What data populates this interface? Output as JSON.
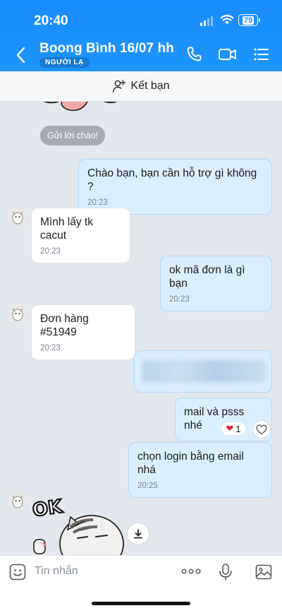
{
  "status_bar": {
    "time": "20:40",
    "battery": "79"
  },
  "header": {
    "title": "Boong Bình 16/07 hh",
    "badge": "NGƯỜI LẠ",
    "icons": [
      "back-icon",
      "phone-icon",
      "video-icon",
      "menu-icon"
    ]
  },
  "add_friend": {
    "label": "Kết bạn",
    "icon": "add-user-icon"
  },
  "greeting_chip": "Gửi lời chào!",
  "messages": [
    {
      "side": "out",
      "text": "Chào bạn, bạn cần hỗ trợ gì không ?",
      "time": "20:23"
    },
    {
      "side": "in",
      "text": "Mình lấy tk cacut",
      "time": "20:23"
    },
    {
      "side": "out",
      "text": "ok mã đơn là gì bạn",
      "time": "20:23"
    },
    {
      "side": "in",
      "text": "Đơn hàng #51949",
      "time": "20:23"
    },
    {
      "side": "out",
      "text": "mail và psss nhé",
      "time": ""
    },
    {
      "side": "out",
      "text": "chọn login bằng email nhá",
      "time": "20:25"
    }
  ],
  "reaction": {
    "icon": "heart-icon",
    "count": "1"
  },
  "sticker_text": "OK",
  "input": {
    "placeholder": "Tin nhắn",
    "icons": [
      "sticker-icon",
      "more-icon",
      "mic-icon",
      "image-icon"
    ]
  },
  "colors": {
    "header": "#1a8cff",
    "outgoing_bubble": "#dbeefe",
    "incoming_bubble": "#ffffff",
    "chat_bg": "#e3e7ee"
  }
}
